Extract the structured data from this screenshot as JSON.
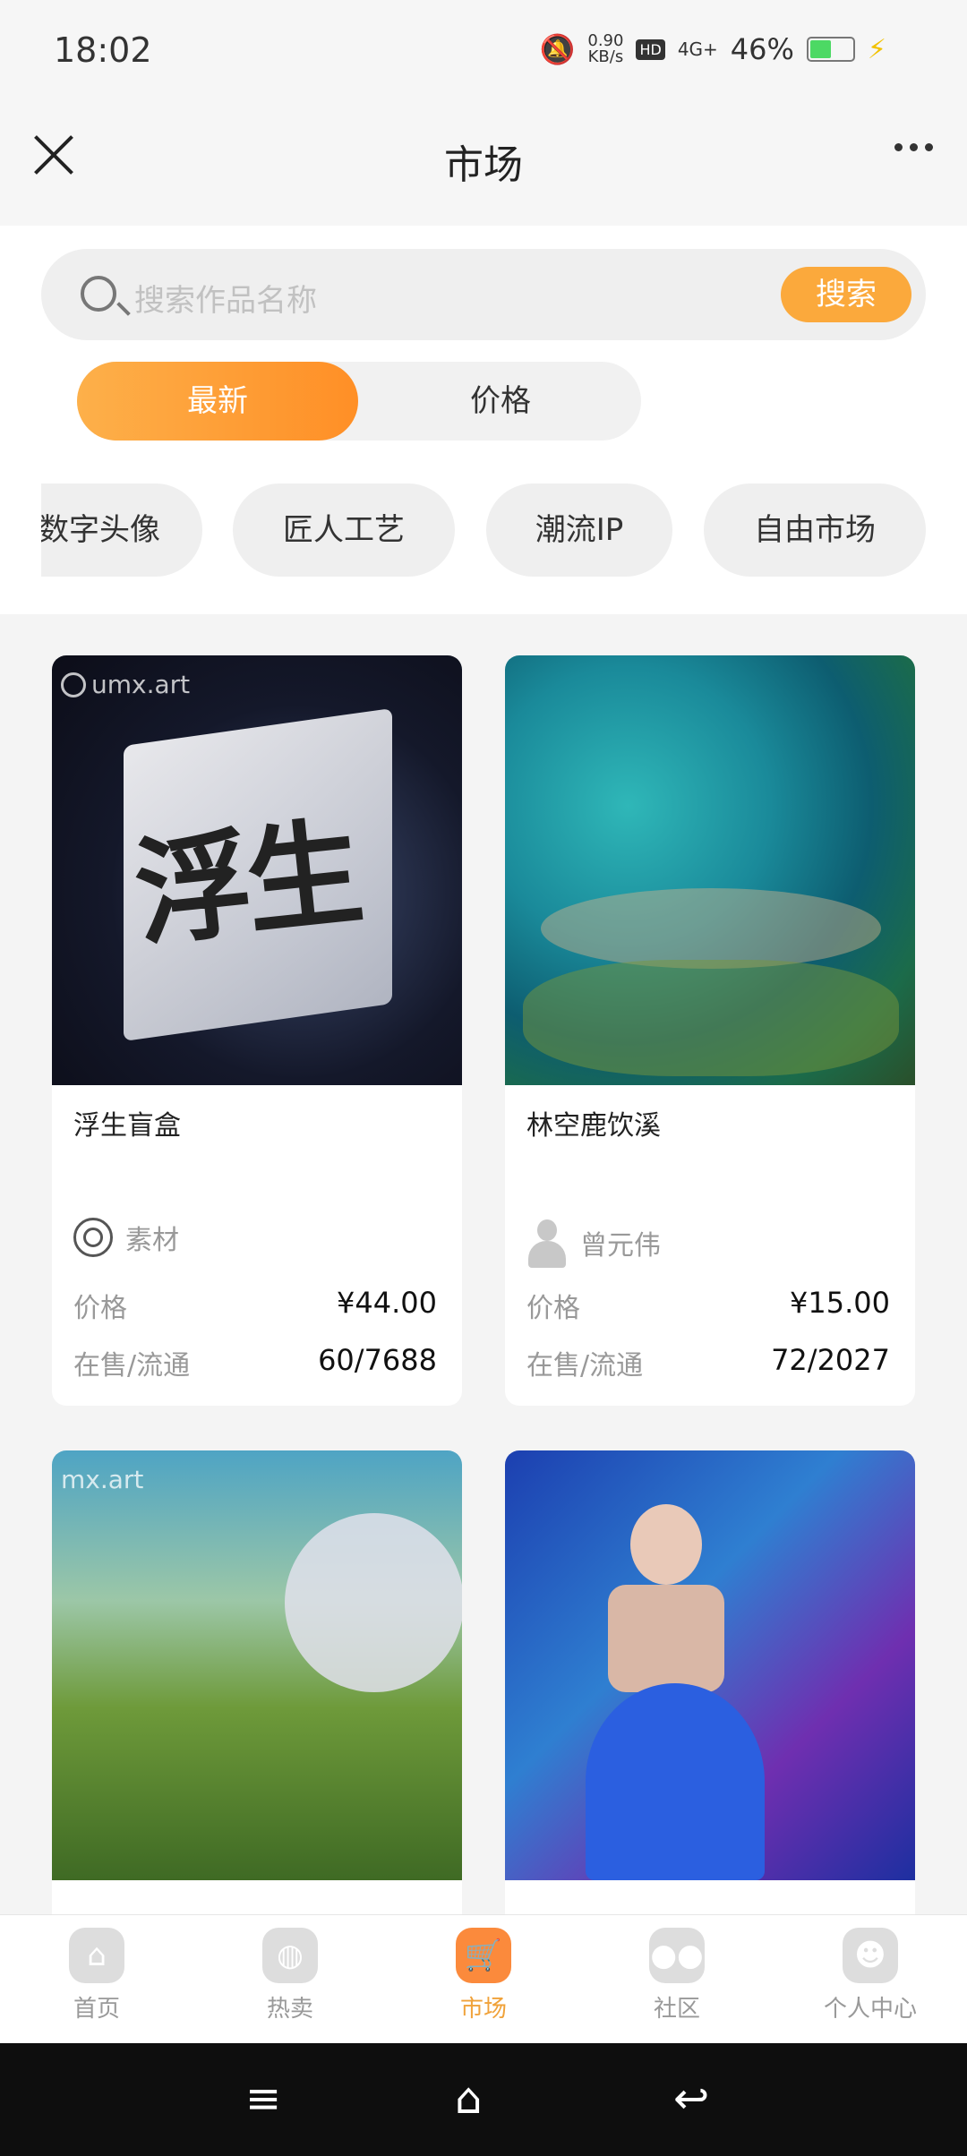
{
  "status": {
    "time": "18:02",
    "speed_value": "0.90",
    "speed_unit": "KB/s",
    "hd": "HD",
    "signal": "4G+",
    "battery": "46%"
  },
  "header": {
    "title": "市场"
  },
  "search": {
    "placeholder": "搜索作品名称",
    "button": "搜索"
  },
  "sort": {
    "active": "最新",
    "inactive": "价格"
  },
  "categories": [
    "数字头像",
    "匠人工艺",
    "潮流IP",
    "自由市场"
  ],
  "watermark": "umx.art",
  "watermark_short": "mx.art",
  "cards": [
    {
      "name": "浮生盲盒",
      "cover_text": "浮生",
      "creator": "素材",
      "price_label": "价格",
      "price": "¥44.00",
      "stock_label": "在售/流通",
      "stock": "60/7688"
    },
    {
      "name": "林空鹿饮溪",
      "creator": "曾元伟",
      "price_label": "价格",
      "price": "¥15.00",
      "stock_label": "在售/流通",
      "stock": "72/2027"
    }
  ],
  "tabs": [
    {
      "label": "首页",
      "icon": "home-icon"
    },
    {
      "label": "热卖",
      "icon": "globe-icon"
    },
    {
      "label": "市场",
      "icon": "cart-icon"
    },
    {
      "label": "社区",
      "icon": "community-icon"
    },
    {
      "label": "个人中心",
      "icon": "profile-icon"
    }
  ],
  "colors": {
    "accent": "#fba93c",
    "active_tab": "#f0a23a",
    "tab_icon_active": "#fb8a3c"
  }
}
